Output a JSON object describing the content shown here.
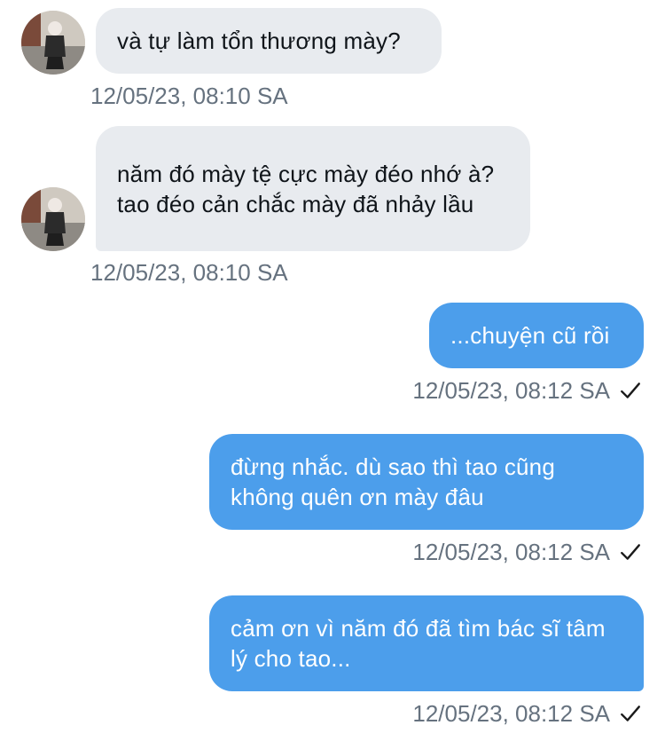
{
  "messages": [
    {
      "direction": "incoming",
      "text": "và tự làm tổn thương mày?",
      "time": "12/05/23, 08:10 SA"
    },
    {
      "direction": "incoming",
      "text": "năm đó mày tệ cực mày đéo nhớ à? tao đéo cản chắc mày đã nhảy lầu",
      "time": "12/05/23, 08:10 SA"
    },
    {
      "direction": "outgoing",
      "text": "...chuyện cũ rồi",
      "time": "12/05/23, 08:12 SA"
    },
    {
      "direction": "outgoing",
      "text": "đừng nhắc. dù sao thì tao cũng không quên ơn mày đâu",
      "time": "12/05/23, 08:12 SA"
    },
    {
      "direction": "outgoing",
      "text": "cảm ơn vì năm đó đã tìm bác sĩ tâm lý cho tao...",
      "time": "12/05/23, 08:12 SA"
    }
  ],
  "icons": {
    "read_receipt": "checkmark-icon",
    "avatar": "user-avatar"
  },
  "colors": {
    "incoming_bubble": "#e8ebef",
    "outgoing_bubble": "#4c9eeb",
    "timestamp": "#66727f"
  }
}
